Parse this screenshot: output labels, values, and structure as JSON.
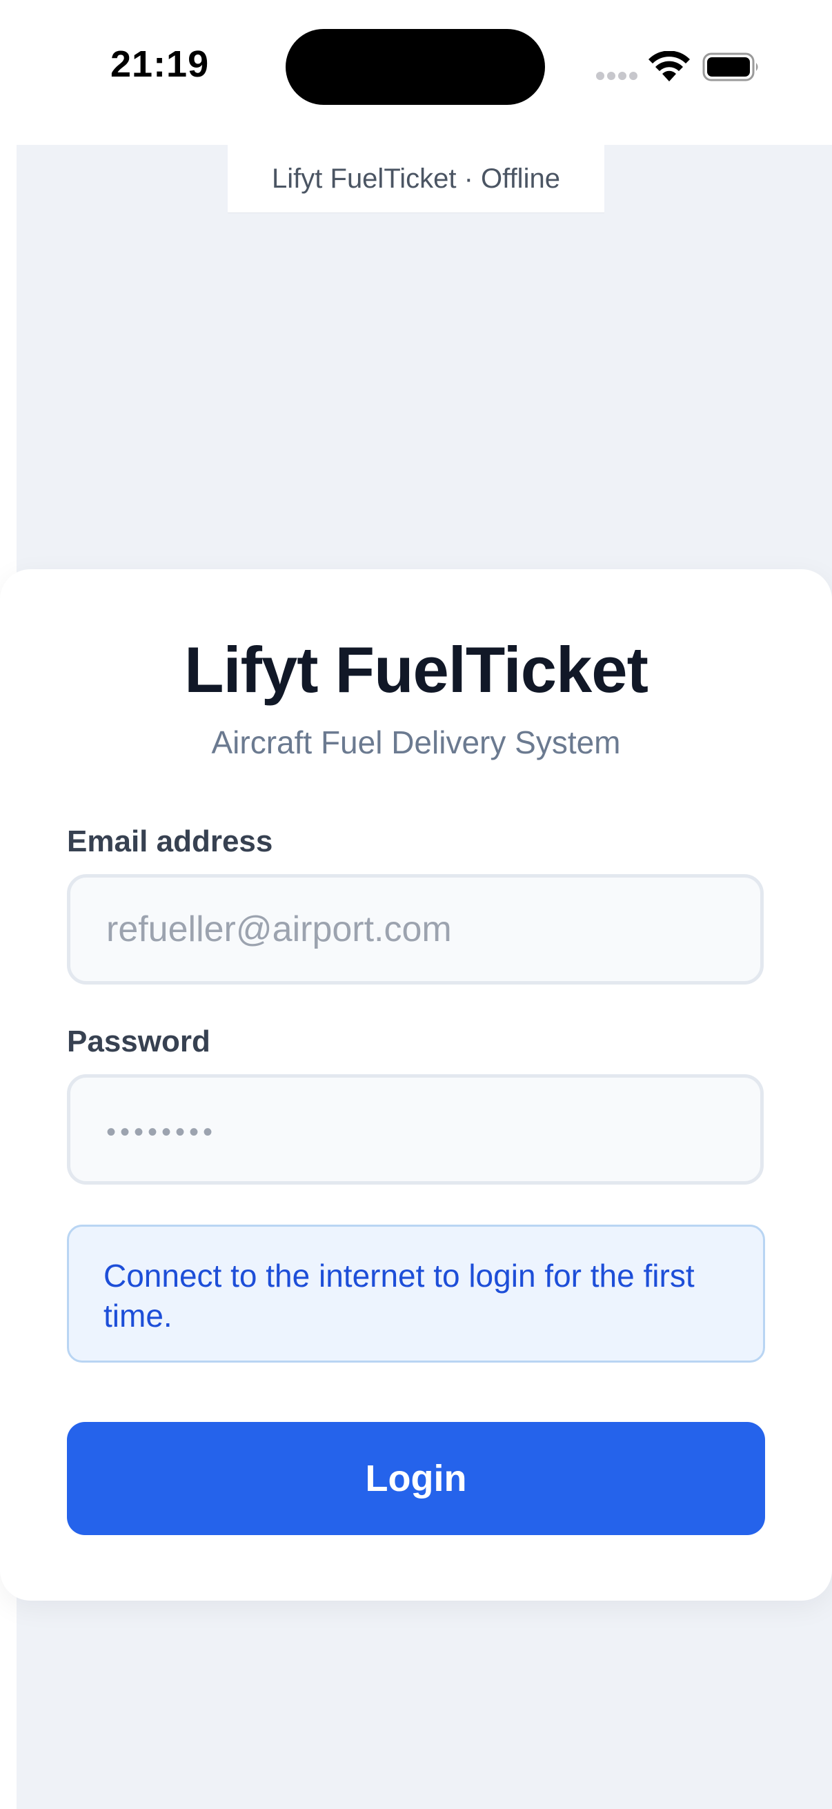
{
  "status_bar": {
    "time": "21:19",
    "icons": [
      "cellular-signal-icon",
      "wifi-icon",
      "battery-icon"
    ]
  },
  "banner": {
    "text": "Lifyt FuelTicket · Offline"
  },
  "login_card": {
    "title": "Lifyt FuelTicket",
    "subtitle": "Aircraft Fuel Delivery System",
    "email_label": "Email address",
    "email_placeholder": "refueller@airport.com",
    "email_value": "",
    "password_label": "Password",
    "password_placeholder": "••••••••",
    "password_value": "",
    "info_message": "Connect to the internet to login for the first time.",
    "login_label": "Login"
  },
  "colors": {
    "background": "#eff2f7",
    "primary": "#2563eb",
    "info_bg": "#edf4fe",
    "info_text": "#1d4ed8",
    "title_text": "#111827"
  }
}
